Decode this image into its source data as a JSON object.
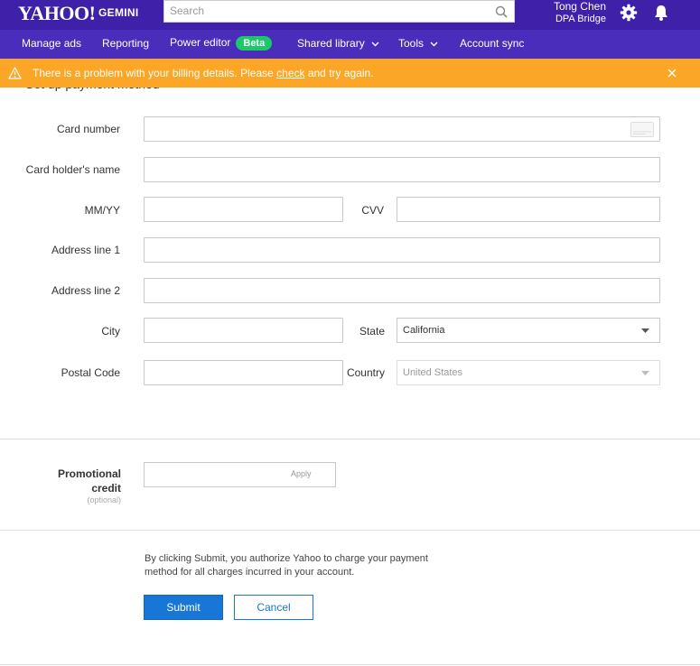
{
  "header": {
    "logo": "YAHOO!",
    "product": "GEMINI",
    "search_placeholder": "Search",
    "user_name": "Tong Chen",
    "account_name": "DPA Bridge"
  },
  "nav": {
    "items": [
      {
        "label": "Manage ads"
      },
      {
        "label": "Reporting"
      },
      {
        "label": "Power editor",
        "badge": "Beta"
      },
      {
        "label": "Shared library"
      },
      {
        "label": "Tools"
      },
      {
        "label": "Account sync"
      }
    ]
  },
  "alert": {
    "before": "There is a problem with your billing details. Please ",
    "link": "check",
    "after": " and try again."
  },
  "form": {
    "title": "Set up payment method",
    "card_number_label": "Card number",
    "card_holder_label": "Card holder's name",
    "expiry_label": "MM/YY",
    "cvv_label": "CVV",
    "address1_label": "Address line 1",
    "address2_label": "Address line 2",
    "city_label": "City",
    "state_label": "State",
    "state_value": "California",
    "postal_label": "Postal Code",
    "country_label": "Country",
    "country_value": "United States"
  },
  "promo": {
    "label": "Promotional credit",
    "optional": "(optional)",
    "apply": "Apply"
  },
  "footer": {
    "legal": "By clicking Submit, you authorize Yahoo to charge your payment method for all charges incurred in your account.",
    "submit": "Submit",
    "cancel": "Cancel"
  },
  "colors": {
    "topbar": "#3f20a8",
    "navbar": "#4b2dbb",
    "alert": "#fba626",
    "beta": "#1cc86a",
    "primary": "#1877d6"
  }
}
